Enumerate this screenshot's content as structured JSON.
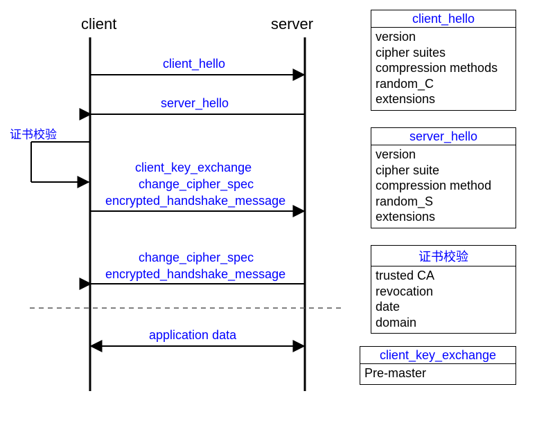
{
  "lifelines": {
    "client": "client",
    "server": "server"
  },
  "msgs": {
    "client_hello": "client_hello",
    "server_hello": "server_hello",
    "self_cert": "证书校验",
    "group_cke": "client_key_exchange",
    "group_ccs1": "change_cipher_spec",
    "group_ehm1": "encrypted_handshake_message",
    "group_ccs2": "change_cipher_spec",
    "group_ehm2": "encrypted_handshake_message",
    "app_data": "application data"
  },
  "boxes": {
    "client_hello": {
      "title": "client_hello",
      "items": [
        "version",
        "cipher suites",
        "compression methods",
        "random_C",
        "extensions"
      ]
    },
    "server_hello": {
      "title": "server_hello",
      "items": [
        "version",
        "cipher suite",
        "compression method",
        "random_S",
        "extensions"
      ]
    },
    "cert_check": {
      "title": "证书校验",
      "items": [
        "trusted CA",
        "revocation",
        "date",
        "domain"
      ]
    },
    "cke": {
      "title": "client_key_exchange",
      "items": [
        "Pre-master"
      ]
    }
  },
  "chart_data": {
    "type": "sequence_diagram",
    "lifelines": [
      "client",
      "server"
    ],
    "messages": [
      {
        "from": "client",
        "to": "server",
        "label": "client_hello"
      },
      {
        "from": "server",
        "to": "client",
        "label": "server_hello"
      },
      {
        "from": "client",
        "to": "client",
        "label": "证书校验"
      },
      {
        "from": "client",
        "to": "server",
        "label": "client_key_exchange / change_cipher_spec / encrypted_handshake_message"
      },
      {
        "from": "server",
        "to": "client",
        "label": "change_cipher_spec / encrypted_handshake_message"
      },
      {
        "divider": true
      },
      {
        "from": "client",
        "to": "server",
        "bidirectional": true,
        "label": "application data"
      }
    ],
    "detail_boxes": {
      "client_hello": [
        "version",
        "cipher suites",
        "compression methods",
        "random_C",
        "extensions"
      ],
      "server_hello": [
        "version",
        "cipher suite",
        "compression method",
        "random_S",
        "extensions"
      ],
      "证书校验": [
        "trusted CA",
        "revocation",
        "date",
        "domain"
      ],
      "client_key_exchange": [
        "Pre-master"
      ]
    }
  }
}
